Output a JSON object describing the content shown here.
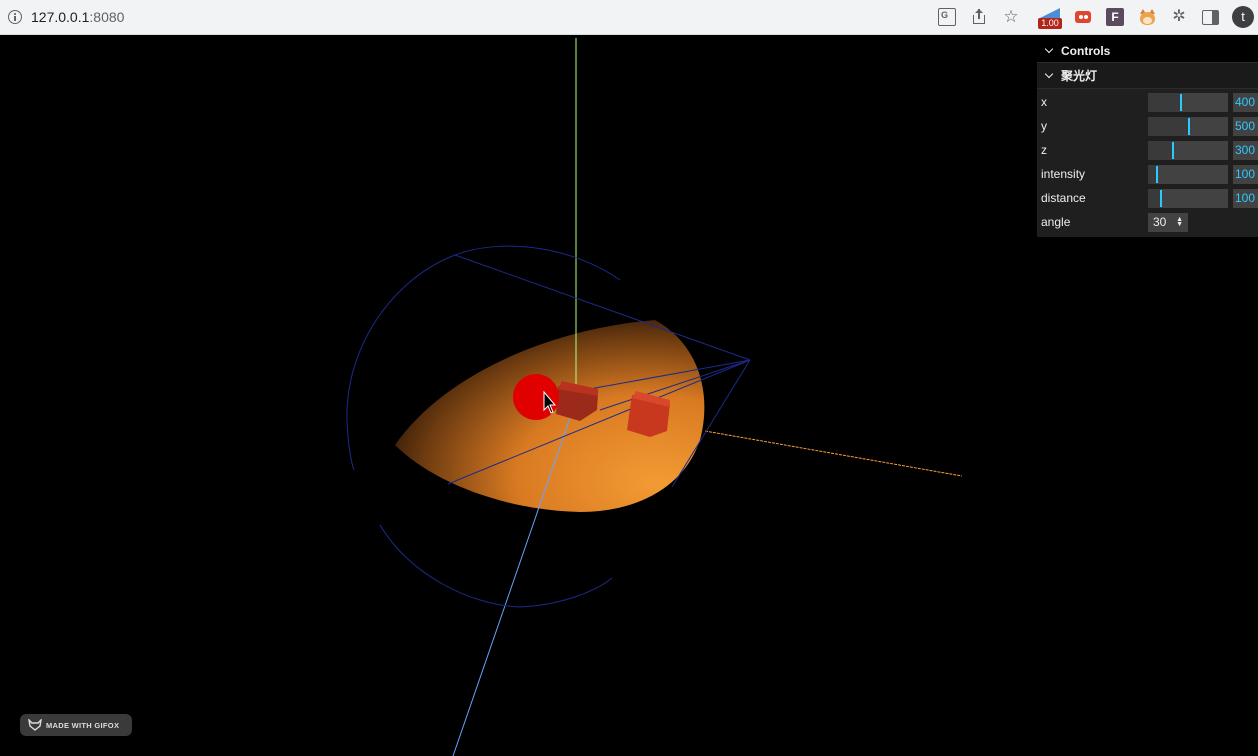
{
  "browser": {
    "url_host": "127.0.0.1",
    "url_port": ":8080",
    "meter_badge": "1.00",
    "ext_letter": "F",
    "avatar_letter": "t",
    "icons": [
      "info-icon",
      "translate-icon",
      "share-icon",
      "star-icon",
      "speedometer-extension-icon",
      "red-extension-icon",
      "f-extension-icon",
      "shiba-extension-icon",
      "puzzle-extensions-icon",
      "side-panel-icon",
      "profile-avatar"
    ]
  },
  "controls": {
    "title": "Controls",
    "folder": "聚光灯",
    "sliders": [
      {
        "label": "x",
        "value": "400",
        "fraction": 0.4
      },
      {
        "label": "y",
        "value": "500",
        "fraction": 0.5
      },
      {
        "label": "z",
        "value": "300",
        "fraction": 0.3
      },
      {
        "label": "intensity",
        "value": "100",
        "fraction": 0.1
      },
      {
        "label": "distance",
        "value": "100",
        "fraction": 0.15
      }
    ],
    "angle": {
      "label": "angle",
      "value": "30"
    }
  },
  "watermark": {
    "text": "MADE WITH GIFOX"
  },
  "colors": {
    "spotlight": "#f0922a",
    "cube": "#b8321f",
    "helper": "#1c2a8a",
    "axis_y": "#b5ff7a",
    "axis_z": "#6aa2ff",
    "axis_x": "#ff9a3a",
    "cursor_highlight": "#e00000",
    "slider_accent": "#2cc9ff"
  }
}
